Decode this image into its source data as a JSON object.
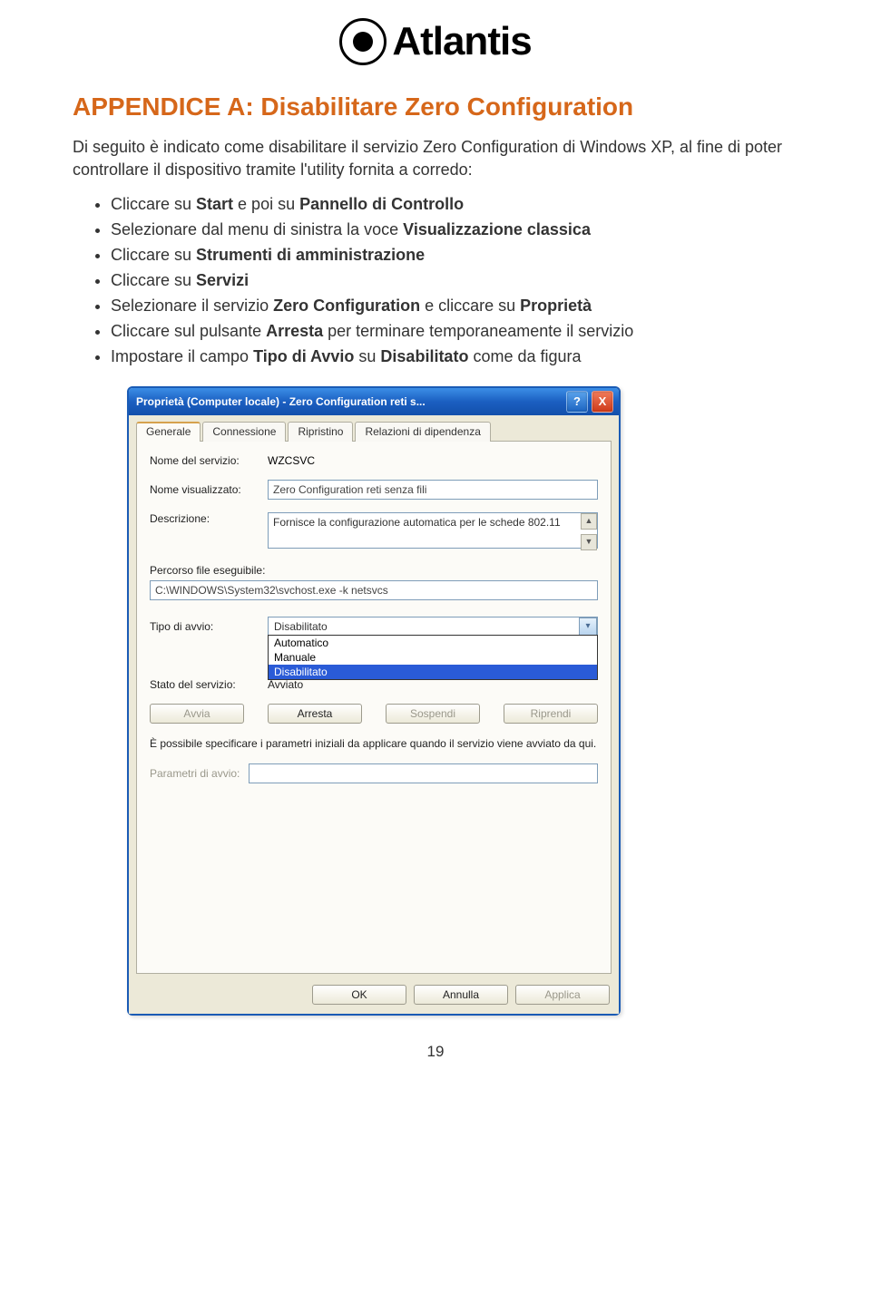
{
  "logo": {
    "brand": "Atlantis"
  },
  "doc": {
    "title": "APPENDICE A: Disabilitare Zero Configuration",
    "intro": "Di seguito è indicato come disabilitare il servizio Zero Configuration di Windows XP, al fine di poter controllare il dispositivo tramite l'utility fornita a corredo:",
    "steps": [
      {
        "pre": "Cliccare su ",
        "b1": "Start",
        "mid": " e poi su ",
        "b2": "Pannello di Controllo"
      },
      {
        "pre": "Selezionare dal menu di sinistra la voce ",
        "b1": "Visualizzazione classica"
      },
      {
        "pre": "Cliccare su ",
        "b1": "Strumenti di amministrazione"
      },
      {
        "pre": "Cliccare su ",
        "b1": "Servizi"
      },
      {
        "pre": "Selezionare il servizio ",
        "b1": "Zero Configuration",
        "mid": " e cliccare su ",
        "b2": "Proprietà"
      },
      {
        "pre": "Cliccare sul pulsante ",
        "b1": "Arresta",
        "mid": " per terminare temporaneamente il servizio"
      },
      {
        "pre": "Impostare il campo ",
        "b1": "Tipo di Avvio",
        "mid": "  su ",
        "b2": "Disabilitato",
        "post": " come da figura"
      }
    ],
    "page_number": "19"
  },
  "dialog": {
    "title": "Proprietà (Computer locale) - Zero Configuration reti s...",
    "help": "?",
    "close": "X",
    "tabs": {
      "t1": "Generale",
      "t2": "Connessione",
      "t3": "Ripristino",
      "t4": "Relazioni di dipendenza"
    },
    "labels": {
      "service_name": "Nome del servizio:",
      "display_name": "Nome visualizzato:",
      "description": "Descrizione:",
      "exe_path": "Percorso file eseguibile:",
      "startup_type": "Tipo di avvio:",
      "service_status": "Stato del servizio:",
      "note": "È possibile specificare i parametri iniziali da applicare quando il servizio viene avviato da qui.",
      "start_params": "Parametri di avvio:"
    },
    "values": {
      "service_name": "WZCSVC",
      "display_name": "Zero Configuration reti senza fili",
      "description": "Fornisce la configurazione automatica per le schede 802.11",
      "exe_path": "C:\\WINDOWS\\System32\\svchost.exe -k netsvcs",
      "startup_selected": "Disabilitato",
      "service_status": "Avviato",
      "start_params": ""
    },
    "dropdown": {
      "o1": "Automatico",
      "o2": "Manuale",
      "o3": "Disabilitato"
    },
    "buttons": {
      "start": "Avvia",
      "stop": "Arresta",
      "pause": "Sospendi",
      "resume": "Riprendi",
      "ok": "OK",
      "cancel": "Annulla",
      "apply": "Applica"
    }
  }
}
